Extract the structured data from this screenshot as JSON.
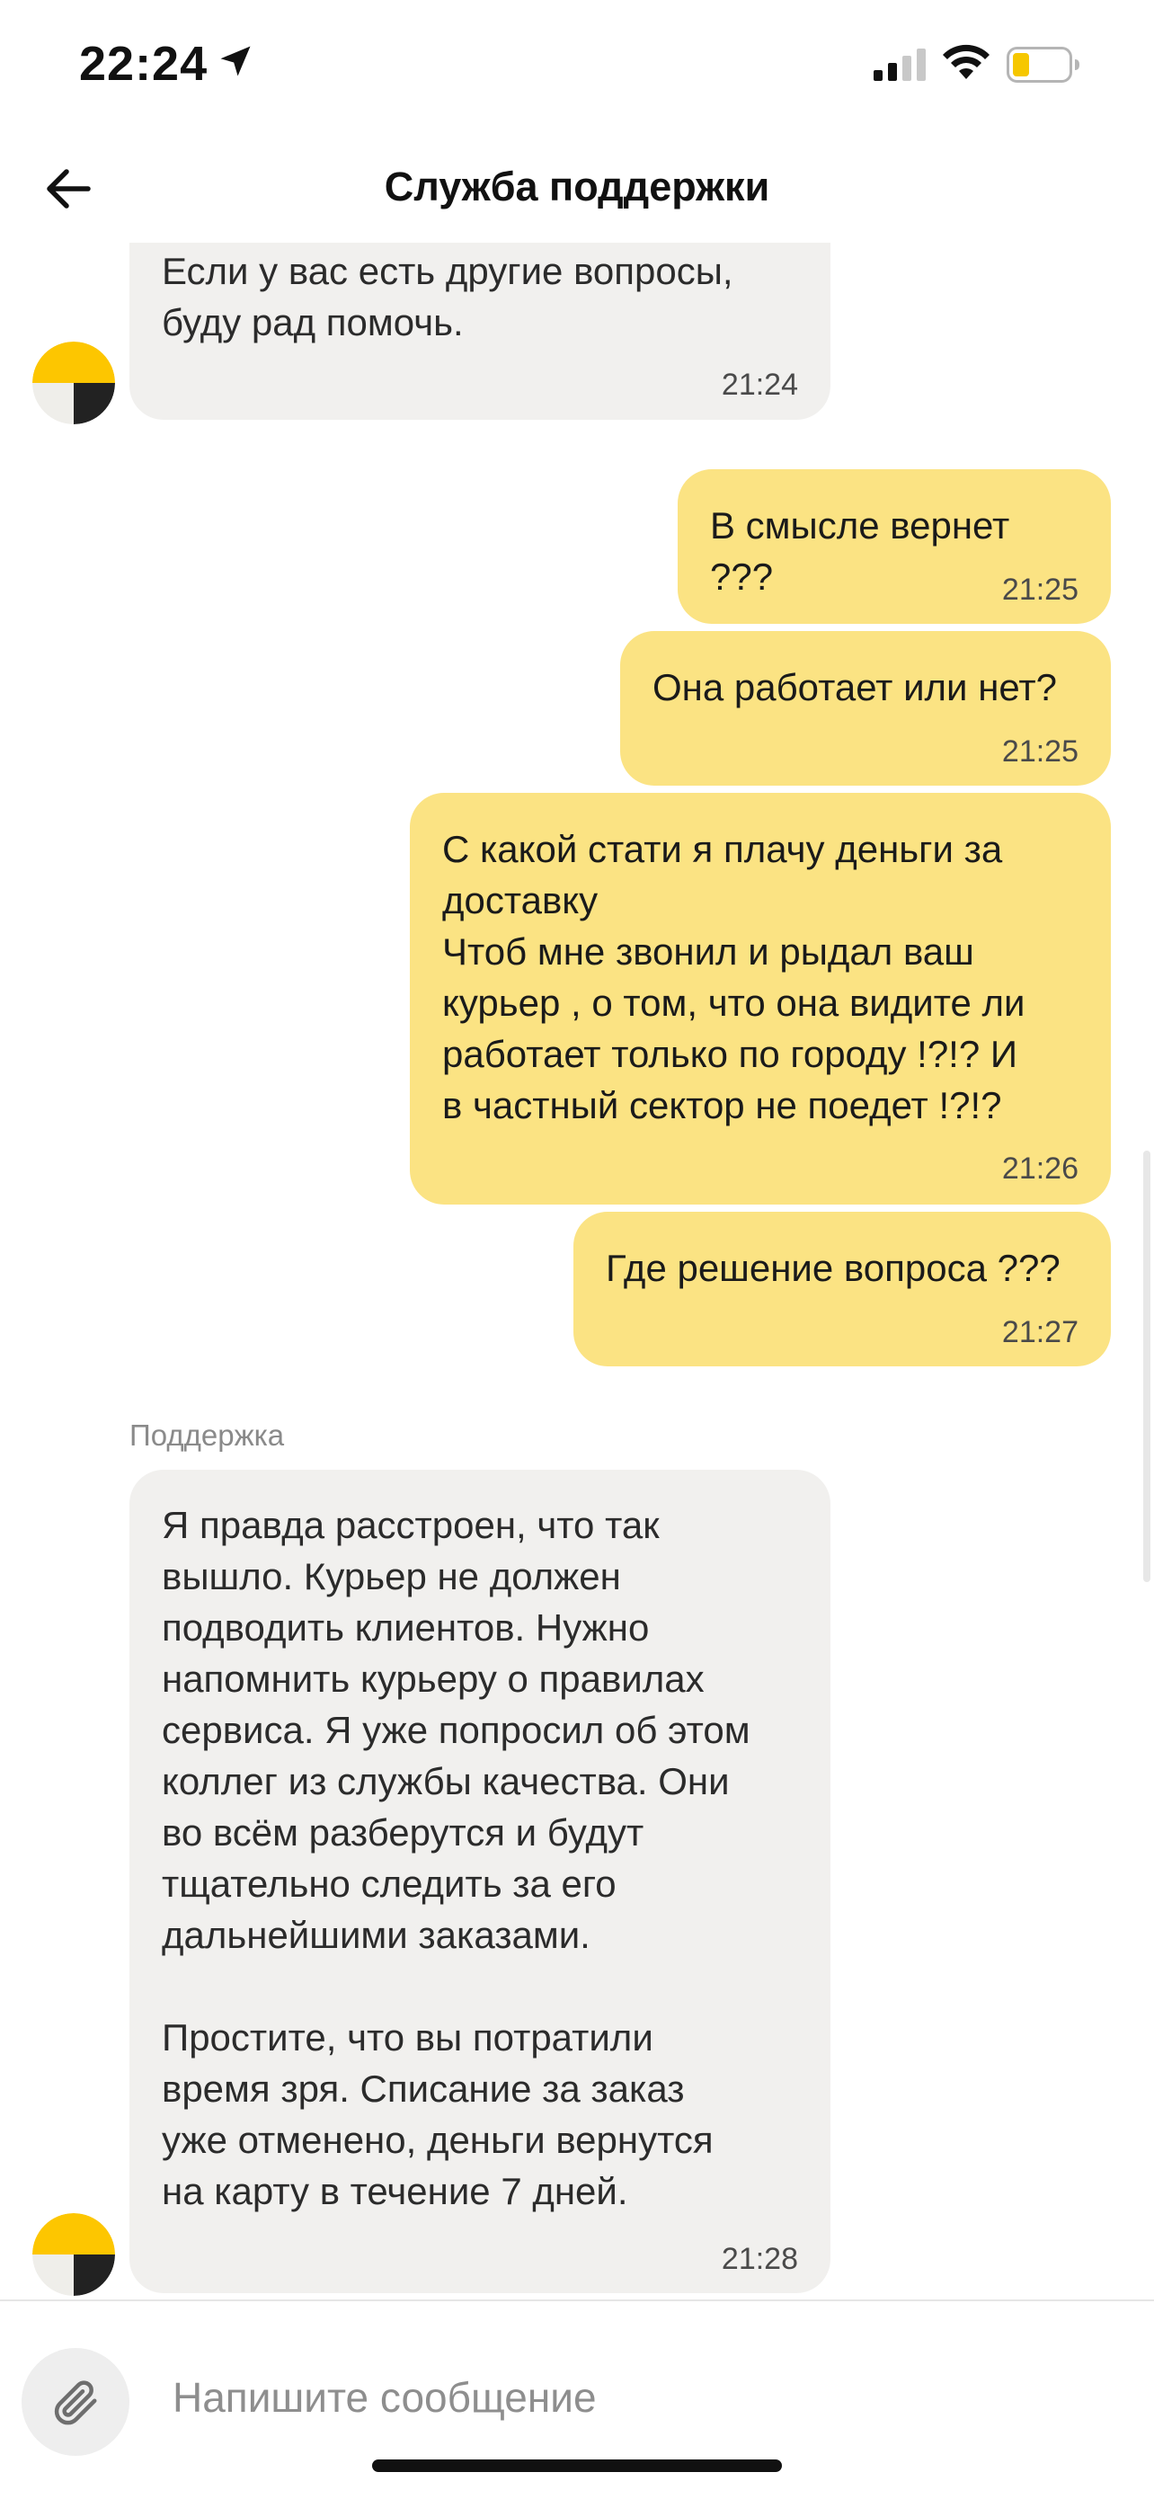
{
  "status_bar": {
    "time": "22:24",
    "icons": [
      "location-arrow-icon",
      "cellular-signal-icon",
      "wifi-icon",
      "battery-low-icon"
    ]
  },
  "header": {
    "back_icon": "arrow-left-icon",
    "title": "Служба поддержки"
  },
  "messages": [
    {
      "from": "support",
      "text": "Если у вас есть другие вопросы,\nбуду рад помочь.",
      "time": "21:24"
    },
    {
      "from": "user",
      "text": "В смысле вернет ???",
      "time": "21:25"
    },
    {
      "from": "user",
      "text": "Она работает или нет?",
      "time": "21:25"
    },
    {
      "from": "user",
      "text": "С какой стати я плачу деньги за\nдоставку\nЧтоб мне звонил и рыдал ваш\nкурьер , о том, что она видите ли\nработает только по городу !?!? И\nв частный сектор не поедет !?!?",
      "time": "21:26"
    },
    {
      "from": "user",
      "text": "Где решение вопроса ???",
      "time": "21:27"
    },
    {
      "from": "support",
      "sender": "Поддержка",
      "text": "Я правда расстроен, что так\nвышло. Курьер не должен\nподводить клиентов. Нужно\nнапомнить курьеру о правилах\nсервиса. Я уже попросил об этом\nколлег из службы качества. Они\nво всём разберутся и будут\nтщательно следить за его\nдальнейшими заказами.\n\nПростите, что вы потратили\nвремя зря. Списание за заказ\nуже отменено, деньги вернутся\nна карту в течение 7 дней.",
      "time": "21:28"
    }
  ],
  "composer": {
    "attach_icon": "paperclip-icon",
    "placeholder": "Напишите сообщение"
  },
  "colors": {
    "user_bubble": "#fbe383",
    "support_bubble": "#f1f0ee",
    "avatar_yellow": "#fdc600",
    "avatar_dark": "#222222",
    "battery_fill": "#f6c700"
  }
}
